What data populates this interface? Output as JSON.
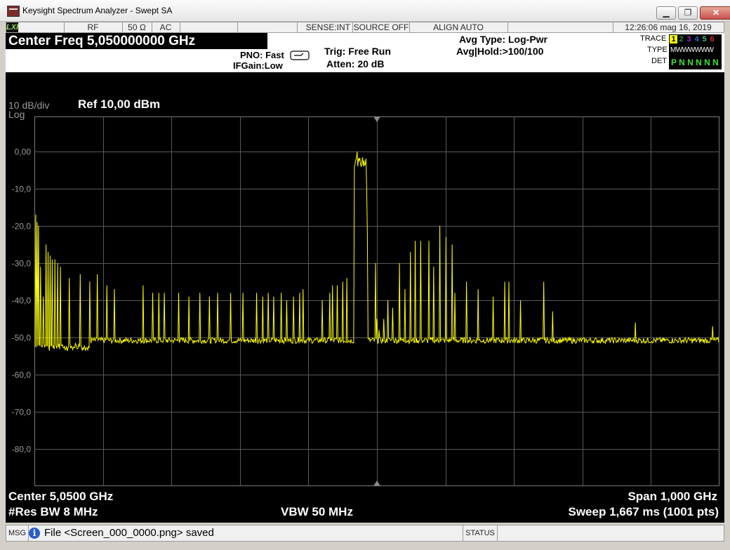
{
  "window": {
    "title": "Keysight Spectrum Analyzer - Swept SA",
    "minimize": "▁",
    "restore": "❐",
    "close": "✕"
  },
  "status_bar": {
    "lxi": "LXI",
    "rf": "RF",
    "impedance": "50 Ω",
    "coupling": "AC",
    "sense": "SENSE:INT",
    "source": "SOURCE OFF",
    "align": "ALIGN AUTO",
    "datetime": "12:26:06 mag 16, 2019"
  },
  "header": {
    "center_freq": "Center Freq 5,050000000 GHz",
    "pno": "PNO: Fast",
    "ifgain": "IFGain:Low",
    "trig": "Trig: Free Run",
    "atten": "Atten: 20 dB",
    "avg_type": "Avg Type: Log-Pwr",
    "avg_hold": "Avg|Hold:>100/100"
  },
  "trace_panel": {
    "trace_label": "TRACE",
    "type_label": "TYPE",
    "det_label": "DET",
    "traces": [
      {
        "num": "1",
        "color": "#000000",
        "highlight": "#ffff00"
      },
      {
        "num": "2",
        "color": "#2b8f2b"
      },
      {
        "num": "3",
        "color": "#9a2bbf"
      },
      {
        "num": "4",
        "color": "#2b6bd6"
      },
      {
        "num": "5",
        "color": "#2bbf7f"
      },
      {
        "num": "6",
        "color": "#d62b2b"
      }
    ],
    "type_value": "MWWWWWW",
    "det_value": "P N N N N N"
  },
  "display": {
    "scale": "10 dB/div",
    "scale_type": "Log",
    "ref": "Ref 10,00 dBm",
    "center": "Center 5,0500 GHz",
    "span": "Span 1,000 GHz",
    "res_bw": "#Res BW 8 MHz",
    "vbw": "VBW 50 MHz",
    "sweep": "Sweep  1,667 ms (1001 pts)"
  },
  "message": {
    "label": "MSG",
    "info_icon": "i",
    "text": "File <Screen_000_0000.png> saved",
    "status_label": "STATUS"
  },
  "chart_data": {
    "type": "line",
    "title": "",
    "xlabel": "",
    "ylabel": "",
    "ref_level_dbm": 10,
    "db_per_div": 10,
    "divisions": 10,
    "ylim": [
      -90,
      10
    ],
    "xlim_ghz": [
      4.55,
      5.55
    ],
    "y_tick_labels": [
      "0,00",
      "-10,0",
      "-20,0",
      "-30,0",
      "-40,0",
      "-50,0",
      "-60,0",
      "-70,0",
      "-80,0"
    ],
    "y_tick_values": [
      0,
      -10,
      -20,
      -30,
      -40,
      -50,
      -60,
      -70,
      -80
    ],
    "noise_floor_dbm": -50.8,
    "trace_color": "#ffff00",
    "spurs": [
      {
        "f": 4.551,
        "dbm": -17
      },
      {
        "f": 4.553,
        "dbm": -19
      },
      {
        "f": 4.555,
        "dbm": -20
      },
      {
        "f": 4.558,
        "dbm": -31
      },
      {
        "f": 4.562,
        "dbm": -39
      },
      {
        "f": 4.566,
        "dbm": -25
      },
      {
        "f": 4.569,
        "dbm": -27
      },
      {
        "f": 4.572,
        "dbm": -28
      },
      {
        "f": 4.575,
        "dbm": -29
      },
      {
        "f": 4.579,
        "dbm": -29
      },
      {
        "f": 4.583,
        "dbm": -30
      },
      {
        "f": 4.587,
        "dbm": -31
      },
      {
        "f": 4.6,
        "dbm": -34
      },
      {
        "f": 4.616,
        "dbm": -33
      },
      {
        "f": 4.63,
        "dbm": -35
      },
      {
        "f": 4.641,
        "dbm": -33
      },
      {
        "f": 4.655,
        "dbm": -36
      },
      {
        "f": 4.666,
        "dbm": -37
      },
      {
        "f": 4.708,
        "dbm": -36
      },
      {
        "f": 4.722,
        "dbm": -38
      },
      {
        "f": 4.731,
        "dbm": -38
      },
      {
        "f": 4.739,
        "dbm": -38
      },
      {
        "f": 4.76,
        "dbm": -38
      },
      {
        "f": 4.775,
        "dbm": -39
      },
      {
        "f": 4.791,
        "dbm": -38
      },
      {
        "f": 4.805,
        "dbm": -39
      },
      {
        "f": 4.817,
        "dbm": -38
      },
      {
        "f": 4.836,
        "dbm": -38
      },
      {
        "f": 4.854,
        "dbm": -38
      },
      {
        "f": 4.874,
        "dbm": -38
      },
      {
        "f": 4.883,
        "dbm": -39
      },
      {
        "f": 4.891,
        "dbm": -38
      },
      {
        "f": 4.899,
        "dbm": -39
      },
      {
        "f": 4.91,
        "dbm": -38
      },
      {
        "f": 4.918,
        "dbm": -40
      },
      {
        "f": 4.928,
        "dbm": -39
      },
      {
        "f": 4.937,
        "dbm": -38
      },
      {
        "f": 4.942,
        "dbm": -37
      },
      {
        "f": 4.97,
        "dbm": -40
      },
      {
        "f": 4.981,
        "dbm": -38
      },
      {
        "f": 4.985,
        "dbm": -36
      },
      {
        "f": 4.992,
        "dbm": -36
      },
      {
        "f": 5.0,
        "dbm": -35
      },
      {
        "f": 5.006,
        "dbm": -34
      },
      {
        "f": 5.048,
        "dbm": -30
      },
      {
        "f": 5.05,
        "dbm": -45
      },
      {
        "f": 5.053,
        "dbm": -48
      },
      {
        "f": 5.06,
        "dbm": -45
      },
      {
        "f": 5.066,
        "dbm": -40
      },
      {
        "f": 5.073,
        "dbm": -42
      },
      {
        "f": 5.083,
        "dbm": -30
      },
      {
        "f": 5.091,
        "dbm": -37
      },
      {
        "f": 5.099,
        "dbm": -27
      },
      {
        "f": 5.106,
        "dbm": -24
      },
      {
        "f": 5.114,
        "dbm": -24
      },
      {
        "f": 5.126,
        "dbm": -24
      },
      {
        "f": 5.133,
        "dbm": -31
      },
      {
        "f": 5.142,
        "dbm": -20
      },
      {
        "f": 5.151,
        "dbm": -23
      },
      {
        "f": 5.16,
        "dbm": -25
      },
      {
        "f": 5.164,
        "dbm": -38
      },
      {
        "f": 5.181,
        "dbm": -35
      },
      {
        "f": 5.198,
        "dbm": -37
      },
      {
        "f": 5.22,
        "dbm": -39
      },
      {
        "f": 5.237,
        "dbm": -35
      },
      {
        "f": 5.243,
        "dbm": -35
      },
      {
        "f": 5.26,
        "dbm": -40
      },
      {
        "f": 5.294,
        "dbm": -35
      },
      {
        "f": 5.307,
        "dbm": -43
      },
      {
        "f": 5.428,
        "dbm": -46
      },
      {
        "f": 5.541,
        "dbm": -47
      }
    ],
    "main_signal": {
      "start_ghz": 5.018,
      "end_ghz": 5.034,
      "plateau_dbm": -1.5,
      "peak_dbm": 0
    }
  }
}
